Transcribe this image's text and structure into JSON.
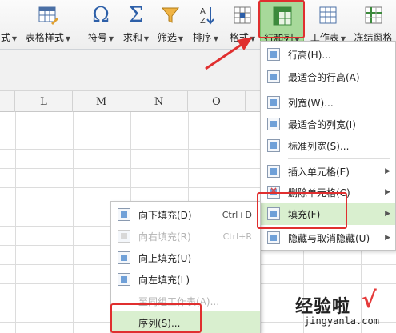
{
  "ribbon": {
    "items": [
      {
        "label": "式",
        "icon": "partial-style-icon"
      },
      {
        "label": "表格样式",
        "icon": "table-style-icon"
      },
      {
        "label": "符号",
        "icon": "omega-symbol-icon"
      },
      {
        "label": "求和",
        "icon": "sigma-sum-icon"
      },
      {
        "label": "筛选",
        "icon": "filter-funnel-icon"
      },
      {
        "label": "排序",
        "icon": "sort-az-icon"
      },
      {
        "label": "格式",
        "icon": "format-grid-icon"
      },
      {
        "label": "行和列",
        "icon": "rows-columns-icon"
      },
      {
        "label": "工作表",
        "icon": "worksheet-icon"
      },
      {
        "label": "冻结窗格",
        "icon": "freeze-panes-icon"
      }
    ]
  },
  "sheet": {
    "columns": [
      "L",
      "M",
      "N",
      "O"
    ]
  },
  "menu_rowcol": {
    "items": [
      {
        "label": "行高(H)...",
        "icon": "row-height-icon"
      },
      {
        "label": "最适合的行高(A)",
        "icon": "autofit-row-icon"
      },
      {
        "label": "列宽(W)...",
        "icon": "column-width-icon"
      },
      {
        "label": "最适合的列宽(I)",
        "icon": "autofit-column-icon"
      },
      {
        "label": "标准列宽(S)...",
        "icon": "standard-width-icon"
      },
      {
        "label": "插入单元格(E)",
        "icon": "insert-cells-icon"
      },
      {
        "label": "删除单元格(C)",
        "icon": "delete-cells-icon"
      },
      {
        "label": "填充(F)",
        "icon": "fill-icon"
      },
      {
        "label": "隐藏与取消隐藏(U)",
        "icon": "hide-unhide-icon"
      }
    ]
  },
  "menu_fill": {
    "items": [
      {
        "label": "向下填充(D)",
        "shortcut": "Ctrl+D",
        "disabled": false,
        "icon": "fill-down-icon"
      },
      {
        "label": "向右填充(R)",
        "shortcut": "Ctrl+R",
        "disabled": true,
        "icon": "fill-right-icon"
      },
      {
        "label": "向上填充(U)",
        "shortcut": "",
        "disabled": false,
        "icon": "fill-up-icon"
      },
      {
        "label": "向左填充(L)",
        "shortcut": "",
        "disabled": false,
        "icon": "fill-left-icon"
      },
      {
        "label": "至同组工作表(A)...",
        "shortcut": "",
        "disabled": true,
        "icon": ""
      },
      {
        "label": "序列(S)...",
        "shortcut": "",
        "disabled": false,
        "icon": ""
      }
    ]
  },
  "watermark": {
    "text": "经验啦",
    "check": "√",
    "url": "jingyanla.com"
  },
  "colors": {
    "highlight": "#a7d99a",
    "menu_highlight": "#d9efcf",
    "annotation_red": "#e02f2f"
  }
}
